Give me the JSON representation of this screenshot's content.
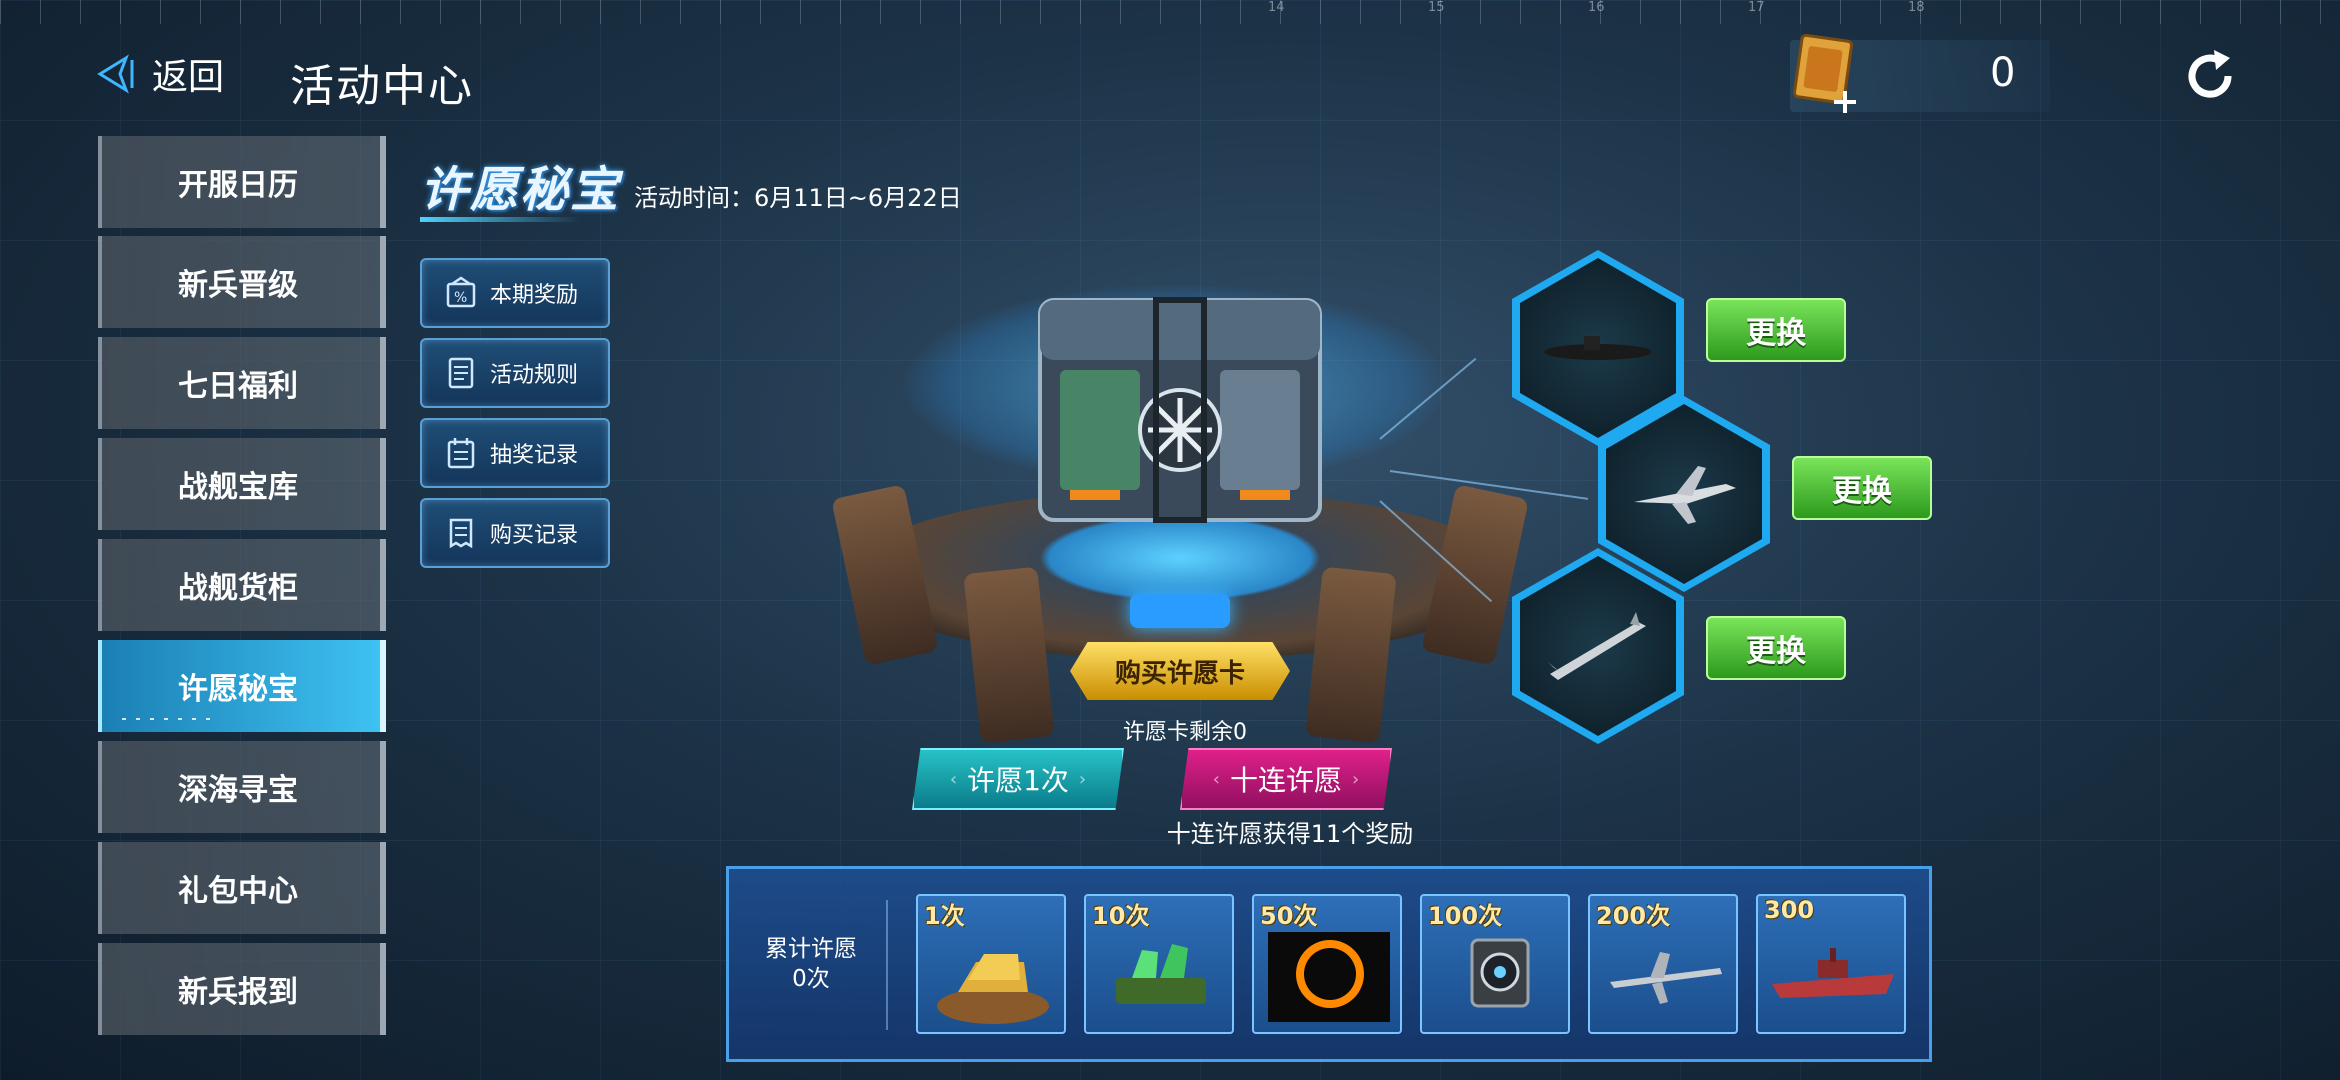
{
  "header": {
    "back_label": "返回",
    "title": "活动中心",
    "currency_value": "0"
  },
  "ruler_numbers": [
    "14",
    "15",
    "16",
    "17",
    "18"
  ],
  "sidebar": {
    "items": [
      {
        "label": "开服日历"
      },
      {
        "label": "新兵晋级"
      },
      {
        "label": "七日福利"
      },
      {
        "label": "战舰宝库"
      },
      {
        "label": "战舰货柜"
      },
      {
        "label": "许愿秘宝",
        "active": true
      },
      {
        "label": "深海寻宝"
      },
      {
        "label": "礼包中心"
      },
      {
        "label": "新兵报到"
      }
    ]
  },
  "event": {
    "title": "许愿秘宝",
    "time": "活动时间：6月11日~6月22日",
    "menu": [
      {
        "label": "本期奖励",
        "icon": "reward-percent-icon"
      },
      {
        "label": "活动规则",
        "icon": "rules-document-icon"
      },
      {
        "label": "抽奖记录",
        "icon": "lottery-record-icon"
      },
      {
        "label": "购买记录",
        "icon": "purchase-record-icon"
      }
    ],
    "buy_card_label": "购买许愿卡",
    "remaining_text": "许愿卡剩余0",
    "wish_once_label": "许愿1次",
    "wish_ten_label": "十连许愿",
    "ten_note": "十连许愿获得11个奖励"
  },
  "wish_slots": [
    {
      "item": "submarine",
      "button": "更换"
    },
    {
      "item": "fighter-jet",
      "button": "更换"
    },
    {
      "item": "missile",
      "button": "更换"
    }
  ],
  "rewards": {
    "cumulative_label": "累计许愿",
    "cumulative_count": "0次",
    "tiers": [
      {
        "label": "1次",
        "item": "gold-bars"
      },
      {
        "label": "10次",
        "item": "green-crystals"
      },
      {
        "label": "50次",
        "item": "eclipse-flag"
      },
      {
        "label": "100次",
        "item": "radar-device"
      },
      {
        "label": "200次",
        "item": "drone-aircraft"
      },
      {
        "label": "300",
        "item": "warship"
      }
    ]
  },
  "colors": {
    "accent_blue": "#1fa9f0",
    "active_tab": "#3ec2f2",
    "change_green": "#2d9a1e",
    "wish_teal": "#0a7c8a",
    "wish_pink": "#e0208a",
    "buy_gold": "#ffe066"
  }
}
